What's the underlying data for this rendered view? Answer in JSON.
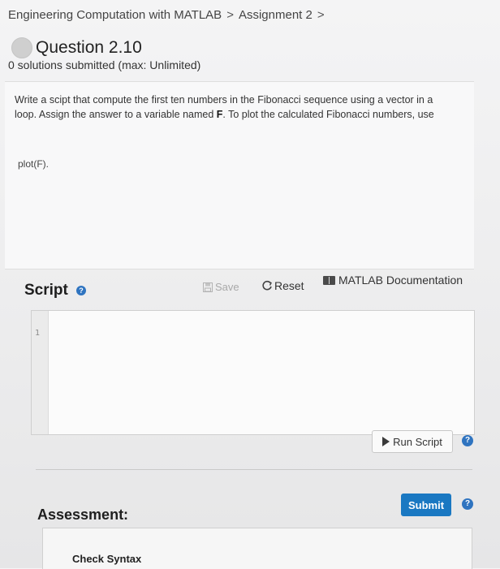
{
  "breadcrumb": {
    "course": "Engineering Computation with MATLAB",
    "separator": ">",
    "assignment": "Assignment 2",
    "trailing": ">"
  },
  "question": {
    "title": "Question 2.10",
    "solutions": "0 solutions submitted (max: Unlimited)"
  },
  "problem": {
    "text_before": "Write a scipt that compute the first ten numbers in the Fibonacci sequence using a vector in a loop. Assign the answer to a variable named ",
    "variable": "F",
    "text_after": ". To plot the calculated Fibonacci numbers, use",
    "code": "plot(F)."
  },
  "script": {
    "label": "Script",
    "save_label": "Save",
    "reset_label": "Reset",
    "doc_label": "MATLAB Documentation",
    "line_numbers": [
      "1"
    ]
  },
  "actions": {
    "run_label": "Run Script",
    "submit_label": "Submit",
    "help_glyph": "?"
  },
  "assessment": {
    "title": "Assessment:",
    "check_label": "Check Syntax"
  },
  "colors": {
    "submit_bg": "#1a78c2",
    "help_icon": "#2f74c0",
    "disabled_text": "#a9a9a9"
  }
}
